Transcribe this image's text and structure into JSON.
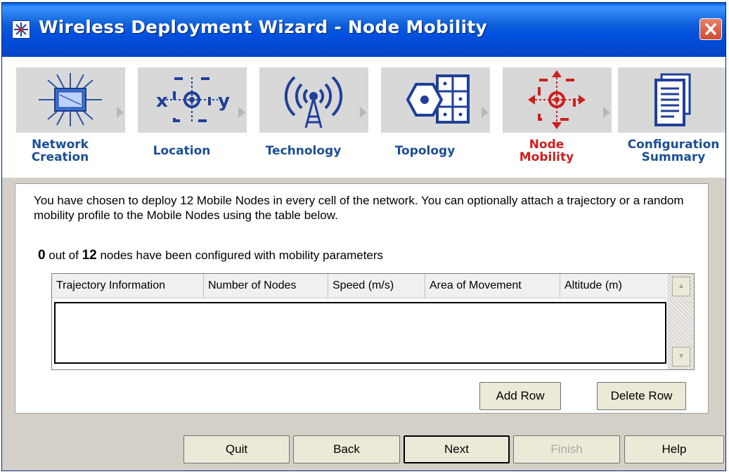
{
  "window": {
    "title": "Wireless Deployment Wizard - Node Mobility"
  },
  "steps": [
    {
      "line1": "Network",
      "line2": "Creation",
      "icon": "network-icon",
      "active": false
    },
    {
      "line1": "Location",
      "line2": "",
      "icon": "location-icon",
      "active": false
    },
    {
      "line1": "Technology",
      "line2": "",
      "icon": "antenna-icon",
      "active": false
    },
    {
      "line1": "Topology",
      "line2": "",
      "icon": "topology-icon",
      "active": false
    },
    {
      "line1": "Node",
      "line2": "Mobility",
      "icon": "mobility-icon",
      "active": true
    },
    {
      "line1": "Configuration",
      "line2": "Summary",
      "icon": "document-icon",
      "active": false
    }
  ],
  "content": {
    "description": "You have chosen to deploy 12 Mobile Nodes in every cell of the network. You can optionally attach a trajectory or a random mobility profile to the Mobile Nodes using the table below.",
    "configured_count": "0",
    "status_mid": "out of",
    "total_count": "12",
    "status_end": "nodes have been configured with mobility parameters"
  },
  "table": {
    "columns": [
      "Trajectory Information",
      "Number of Nodes",
      "Speed (m/s)",
      "Area of Movement",
      "Altitude (m)"
    ],
    "rows": []
  },
  "table_buttons": {
    "add_row": "Add Row",
    "delete_row": "Delete Row"
  },
  "footer_buttons": {
    "quit": "Quit",
    "back": "Back",
    "next": "Next",
    "finish": "Finish",
    "help": "Help"
  },
  "colors": {
    "title_bar": "#0f5fd8",
    "step_label": "#1b4f96",
    "step_label_active": "#cc1f1f"
  }
}
